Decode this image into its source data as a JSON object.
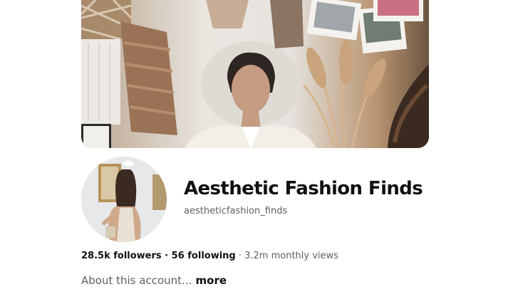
{
  "profile": {
    "display_name": "Aesthetic Fashion Finds",
    "handle": "aestheticfashion_finds",
    "cover_image": "fashion-moodboard-collage",
    "avatar_image": "woman-in-gallery-photo"
  },
  "stats": {
    "followers": "28.5k followers",
    "separator": " · ",
    "following": "56 following",
    "monthly_views": " · 3.2m monthly views"
  },
  "about": {
    "text": "About this account...",
    "more_label": " more"
  },
  "colors": {
    "text_primary": "#111111",
    "text_secondary": "#5f5f5f",
    "background": "#ffffff"
  }
}
